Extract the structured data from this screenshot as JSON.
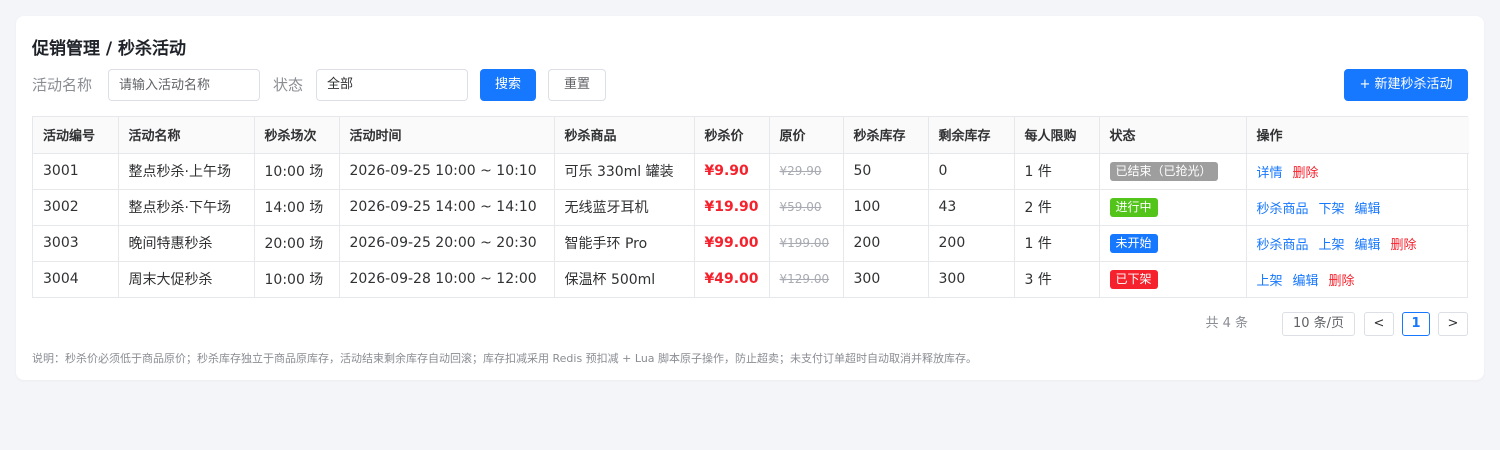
{
  "header": {
    "title": "促销管理 / 秒杀活动"
  },
  "filters": {
    "name_label": "活动名称",
    "name_placeholder": "请输入活动名称",
    "status_label": "状态",
    "status_value": "全部",
    "search_label": "搜索",
    "reset_label": "重置",
    "create_label": "+ 新建秒杀活动"
  },
  "table": {
    "columns": [
      "活动编号",
      "活动名称",
      "秒杀场次",
      "活动时间",
      "秒杀商品",
      "秒杀价",
      "原价",
      "秒杀库存",
      "剩余库存",
      "每人限购",
      "状态",
      "操作"
    ],
    "rows": [
      {
        "id": "3001",
        "name": "整点秒杀·上午场",
        "session": "10:00 场",
        "time": "2026-09-25 10:00 ~ 10:10",
        "product": "可乐 330ml 罐装",
        "price": "¥9.90",
        "original": "¥29.90",
        "stock": "50",
        "remaining": "0",
        "limit": "1 件",
        "status": "已结束（已抢光）",
        "status_color": "#9e9e9e",
        "actions": [
          {
            "label": "详情",
            "color": "blue"
          },
          {
            "label": "删除",
            "color": "red"
          }
        ]
      },
      {
        "id": "3002",
        "name": "整点秒杀·下午场",
        "session": "14:00 场",
        "time": "2026-09-25 14:00 ~ 14:10",
        "product": "无线蓝牙耳机",
        "price": "¥19.90",
        "original": "¥59.00",
        "stock": "100",
        "remaining": "43",
        "limit": "2 件",
        "status": "进行中",
        "status_color": "#52c41a",
        "actions": [
          {
            "label": "秒杀商品",
            "color": "blue"
          },
          {
            "label": "下架",
            "color": "blue"
          },
          {
            "label": "编辑",
            "color": "blue"
          }
        ]
      },
      {
        "id": "3003",
        "name": "晚间特惠秒杀",
        "session": "20:00 场",
        "time": "2026-09-25 20:00 ~ 20:30",
        "product": "智能手环 Pro",
        "price": "¥99.00",
        "original": "¥199.00",
        "stock": "200",
        "remaining": "200",
        "limit": "1 件",
        "status": "未开始",
        "status_color": "#1677ff",
        "actions": [
          {
            "label": "秒杀商品",
            "color": "blue"
          },
          {
            "label": "上架",
            "color": "blue"
          },
          {
            "label": "编辑",
            "color": "blue"
          },
          {
            "label": "删除",
            "color": "red"
          }
        ]
      },
      {
        "id": "3004",
        "name": "周末大促秒杀",
        "session": "10:00 场",
        "time": "2026-09-28 10:00 ~ 12:00",
        "product": "保温杯 500ml",
        "price": "¥49.00",
        "original": "¥129.00",
        "stock": "300",
        "remaining": "300",
        "limit": "3 件",
        "status": "已下架",
        "status_color": "#f5222d",
        "actions": [
          {
            "label": "上架",
            "color": "blue"
          },
          {
            "label": "编辑",
            "color": "blue"
          },
          {
            "label": "删除",
            "color": "red"
          }
        ]
      }
    ]
  },
  "pagination": {
    "total": "共 4 条",
    "page_size": "10 条/页",
    "prev": "<",
    "current": "1",
    "next": ">"
  },
  "note": "说明：秒杀价必须低于商品原价；秒杀库存独立于商品原库存，活动结束剩余库存自动回滚；库存扣减采用 Redis 预扣减 + Lua 脚本原子操作，防止超卖；未支付订单超时自动取消并释放库存。",
  "colors": {
    "primary": "#1677ff",
    "danger": "#f5222d",
    "success": "#52c41a",
    "muted": "#9e9e9e"
  }
}
